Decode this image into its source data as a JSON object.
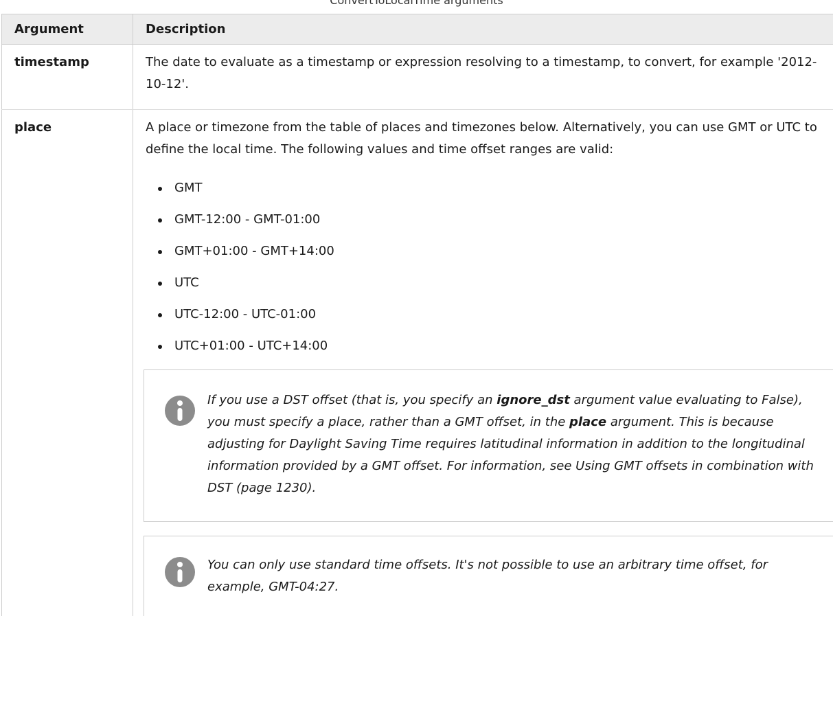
{
  "caption": "ConvertToLocalTime arguments",
  "table": {
    "headers": [
      "Argument",
      "Description"
    ],
    "rows": {
      "timestamp": {
        "arg": "timestamp",
        "desc": "The date to evaluate as a timestamp or expression resolving to a timestamp, to convert, for example '2012-10-12'."
      },
      "place": {
        "arg": "place",
        "intro": "A place or timezone from the table of places and timezones below. Alternatively, you can use GMT or UTC to define the local time. The following values and time offset ranges are valid:",
        "values": [
          "GMT",
          "GMT-12:00 - GMT-01:00",
          "GMT+01:00 - GMT+14:00",
          "UTC",
          "UTC-12:00 - UTC-01:00",
          "UTC+01:00 - UTC+14:00"
        ],
        "note1": {
          "part1": "If you use a DST offset (that is, you specify an ",
          "bold1": "ignore_dst",
          "part2": " argument value evaluating to False), you must specify a place, rather than a GMT offset, in the ",
          "bold2": "place",
          "part3": " argument. This is because adjusting for Daylight Saving Time requires latitudinal information in addition to the longitudinal information provided by a GMT offset. For information, see Using GMT offsets in combination with DST (page 1230)."
        },
        "note2": "You can only use standard time offsets. It's not possible to use an arbitrary time offset, for example, GMT-04:27."
      }
    }
  },
  "icons": {
    "note_icon": "info-icon",
    "note_icon_color": "#8c8c8c"
  }
}
